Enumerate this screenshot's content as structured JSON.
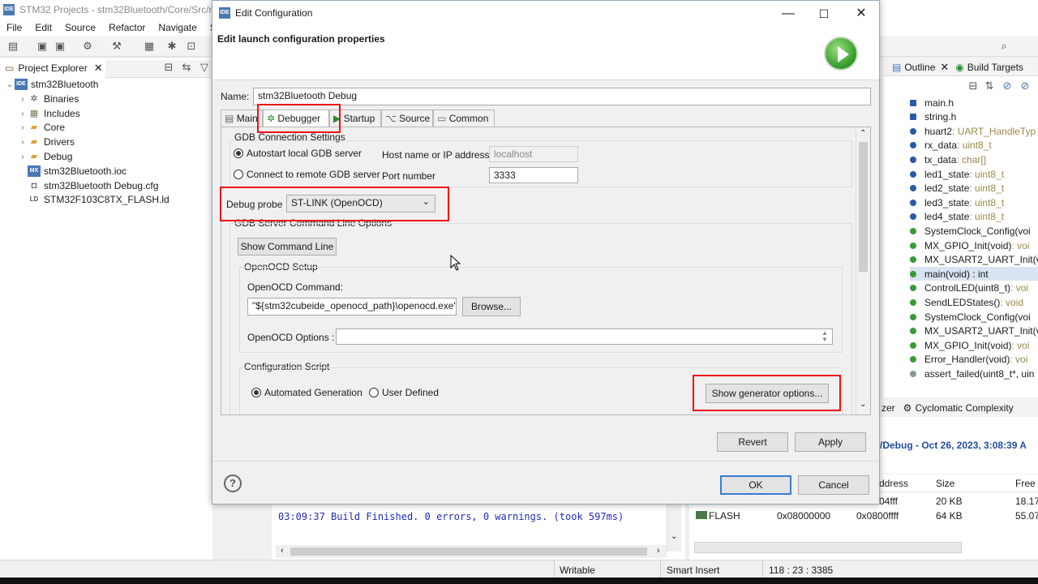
{
  "main_window": {
    "title": "STM32 Projects - stm32Bluetooth/Core/Src/m",
    "menu": [
      "File",
      "Edit",
      "Source",
      "Refactor",
      "Navigate",
      "Sear"
    ]
  },
  "explorer": {
    "tab_label": "Project Explorer",
    "project": "stm32Bluetooth",
    "items": [
      {
        "label": "Binaries",
        "icon": "binaries-icon"
      },
      {
        "label": "Includes",
        "icon": "includes-icon"
      },
      {
        "label": "Core",
        "icon": "folder-icon"
      },
      {
        "label": "Drivers",
        "icon": "folder-icon"
      },
      {
        "label": "Debug",
        "icon": "folder-icon"
      },
      {
        "label": "stm32Bluetooth.ioc",
        "icon": "mx-file-icon"
      },
      {
        "label": "stm32Bluetooth Debug.cfg",
        "icon": "cfg-file-icon"
      },
      {
        "label": "STM32F103C8TX_FLASH.ld",
        "icon": "ld-file-icon"
      }
    ]
  },
  "outline": {
    "tab_outline": "Outline",
    "tab_build_targets": "Build Targets",
    "items": [
      {
        "name": "main.h",
        "type": ""
      },
      {
        "name": "string.h",
        "type": ""
      },
      {
        "name": "huart2",
        "type": " : UART_HandleTyp"
      },
      {
        "name": "rx_data",
        "type": " : uint8_t"
      },
      {
        "name": "tx_data",
        "type": " : char[]"
      },
      {
        "name": "led1_state",
        "type": " : uint8_t"
      },
      {
        "name": "led2_state",
        "type": " : uint8_t"
      },
      {
        "name": "led3_state",
        "type": " : uint8_t"
      },
      {
        "name": "led4_state",
        "type": " : uint8_t"
      },
      {
        "name": "SystemClock_Config(voi",
        "type": ""
      },
      {
        "name": "MX_GPIO_Init(void)",
        "type": " : voi"
      },
      {
        "name": "MX_USART2_UART_Init(vo",
        "type": ""
      },
      {
        "name": "main(void) : int",
        "type": ""
      },
      {
        "name": "ControlLED(uint8_t)",
        "type": " : voi"
      },
      {
        "name": "SendLEDStates()",
        "type": " : void"
      },
      {
        "name": "SystemClock_Config(voi",
        "type": ""
      },
      {
        "name": "MX_USART2_UART_Init(vo",
        "type": ""
      },
      {
        "name": "MX_GPIO_Init(void)",
        "type": " : voi"
      },
      {
        "name": "Error_Handler(void)",
        "type": " : voi"
      },
      {
        "name": "assert_failed(uint8_t*, uin",
        "type": ""
      }
    ]
  },
  "lower": {
    "analyzer_fragment": "zer",
    "cyclomatic_tab": "Cyclomatic Complexity",
    "build_title": "/Debug - Oct 26, 2023, 3:08:39 A",
    "console_line": "03:09:37 Build Finished. 0 errors, 0 warnings. (took 597ms)",
    "mem_headers": [
      "ddress",
      "Size",
      "Free"
    ],
    "mem_rows": [
      {
        "name": "",
        "start": "",
        "end": "04fff",
        "size": "20 KB",
        "free": "18.17"
      },
      {
        "name": "FLASH",
        "start": "0x08000000",
        "end": "0x0800ffff",
        "size": "64 KB",
        "free": "55.07"
      }
    ]
  },
  "statusbar": {
    "writable": "Writable",
    "insert_mode": "Smart Insert",
    "position": "118 : 23 : 3385"
  },
  "dialog": {
    "window_title": "Edit Configuration",
    "header": "Edit launch configuration properties",
    "name_label": "Name:",
    "name_value": "stm32Bluetooth Debug",
    "tabs": [
      "Main",
      "Debugger",
      "Startup",
      "Source",
      "Common"
    ],
    "active_tab": "Debugger",
    "gdb_group": "GDB Connection Settings",
    "autostart_label": "Autostart local GDB server",
    "connect_remote_label": "Connect to remote GDB server",
    "host_label": "Host name or IP address",
    "host_value": "localhost",
    "port_label": "Port number",
    "port_value": "3333",
    "debug_probe_label": "Debug probe",
    "debug_probe_value": "ST-LINK (OpenOCD)",
    "server_options_group": "GDB Server Command Line Options",
    "show_cmd_button": "Show Command Line",
    "openocd_setup_group": "OpenOCD Setup",
    "openocd_command_label": "OpenOCD Command:",
    "openocd_command_value": "\"${stm32cubeide_openocd_path}\\openocd.exe\"",
    "browse_button": "Browse...",
    "openocd_options_label": "OpenOCD Options :",
    "openocd_options_value": "",
    "config_script_group": "Configuration Script",
    "automated_label": "Automated Generation",
    "user_defined_label": "User Defined",
    "generator_button": "Show generator options...",
    "revert_button": "Revert",
    "apply_button": "Apply",
    "ok_button": "OK",
    "cancel_button": "Cancel",
    "help_symbol": "?"
  },
  "colors": {
    "highlight_box": "#e11111",
    "ide_blue": "#4a78b5",
    "console_text": "#1f2db5",
    "outline_type_text": "#9a8a4a"
  }
}
